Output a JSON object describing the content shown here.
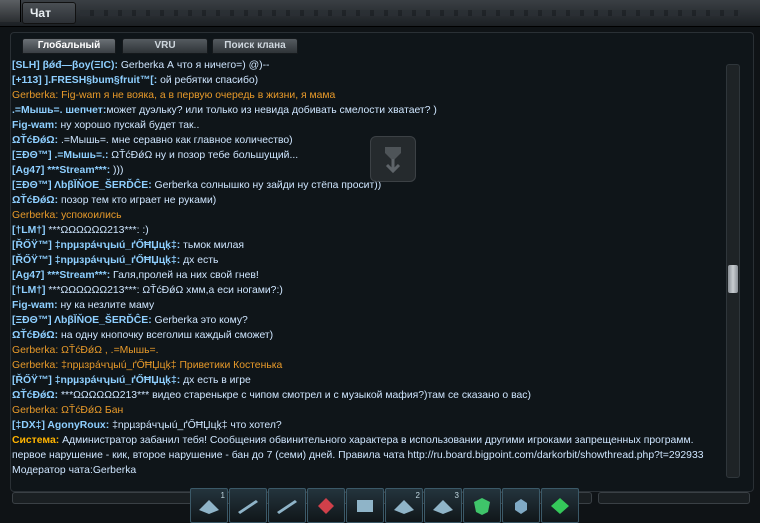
{
  "window": {
    "title": "Чат"
  },
  "tabs": [
    {
      "label": "Глобальный",
      "active": true
    },
    {
      "label": "VRU",
      "active": false
    },
    {
      "label": "Поиск клана",
      "active": false
    }
  ],
  "chat": [
    {
      "type": "user",
      "prefix": "[SLH] βǿđ—βoy(ΞIC):",
      "text": " Gerberka А что я ничего=) @)--"
    },
    {
      "type": "user",
      "prefix": "[+113] ].FRESH§bum§fruit™[:",
      "text": " ой ребятки спасибо)"
    },
    {
      "type": "pm",
      "prefix": "Gerberka:",
      "text": " Fig-wam  я не вояка, а в первую очередь в жизни, я мама"
    },
    {
      "type": "user",
      "prefix": ".=Мышь=. шепчет:",
      "text": "может дуэльку? или только из невида добивать смелости хватает? )"
    },
    {
      "type": "user",
      "prefix": "Fig-wam:",
      "text": " ну хорошо пускай будет так.."
    },
    {
      "type": "user",
      "prefix": "ΩŤćĐǿΩ:",
      "text": " .=Мышь=. мне серавно как главное количество)"
    },
    {
      "type": "user",
      "prefix": "[ΞĐΘ™] .=Мышь=.:",
      "text": " ΩŤćĐǿΩ ну и позор тебе большущий..."
    },
    {
      "type": "user",
      "prefix": "[Ag47] ***Stream***:",
      "text": " )))"
    },
    {
      "type": "user",
      "prefix": "[ΞĐΘ™] ΛbβĬŇOE_ŠERĎĈE:",
      "text": " Gerberka солнышко ну зайди ну стёпа просит))"
    },
    {
      "type": "user",
      "prefix": "ΩŤćĐǿΩ:",
      "text": " позор тем кто играет не руками)"
    },
    {
      "type": "pm",
      "prefix": "Gerberka:",
      "text": "  успокоились"
    },
    {
      "type": "user",
      "prefix": "[†LM†]",
      "text": " ***ΩΩΩΩΩΩ213***: :)"
    },
    {
      "type": "user",
      "prefix": "[ŘŐŸ™] ‡npµɜpáчʮыú_ґŐĦЏцķ‡:",
      "text": " тьмок милая"
    },
    {
      "type": "user",
      "prefix": "[ŘŐŸ™] ‡npµɜpáчʮыú_ґŐĦЏцķ‡:",
      "text": " дх есть"
    },
    {
      "type": "user",
      "prefix": "[Ag47] ***Stream***:",
      "text": " Галя,пролей на них свой гнев!"
    },
    {
      "type": "user",
      "prefix": "[†LM†]",
      "text": " ***ΩΩΩΩΩΩ213***: ΩŤćĐǿΩ хмм,а еси ногами?:)"
    },
    {
      "type": "user",
      "prefix": "Fig-wam:",
      "text": " ну ка незлите маму"
    },
    {
      "type": "user",
      "prefix": "[ΞĐΘ™] ΛbβĬŇOE_ŠERĎĈE:",
      "text": " Gerberka это кому?"
    },
    {
      "type": "user",
      "prefix": "ΩŤćĐǿΩ:",
      "text": " на одну кнопочку всеголиш каждый сможет)"
    },
    {
      "type": "pm",
      "prefix": "Gerberka:",
      "text": "  ΩŤćĐǿΩ , .=Мышь=."
    },
    {
      "type": "pm",
      "prefix": "Gerberka:",
      "text": "  ‡npµɜpáчʮыú_ґŐĦЏцķ‡ Приветики Костенька"
    },
    {
      "type": "user",
      "prefix": "[ŘŐŸ™] ‡npµɜpáчʮыú_ґŐĦЏцķ‡:",
      "text": " дх есть в  игре"
    },
    {
      "type": "user",
      "prefix": "ΩŤćĐǿΩ:",
      "text": " ***ΩΩΩΩΩΩ213*** видео старенькре с чипом смотрел и с музыкой мафия?)там се сказано о вас)"
    },
    {
      "type": "pm",
      "prefix": "Gerberka:",
      "text": "  ΩŤćĐǿΩ Бан"
    },
    {
      "type": "user",
      "prefix": "[‡DX‡] AgonyRoux:",
      "text": " ‡npµɜpáчʮыú_ґŐĦЏцķ‡ что хотел?"
    },
    {
      "type": "system",
      "prefix": "Система:",
      "text": " Администратор забанил тебя! Сообщения обвинительного характера в использовании другими игроками запрещенных программ. первое нарушение - кик, второе нарушение - бан до 7 (семи) дней. Правила чата http://ru.board.bigpoint.com/darkorbit/showthread.php?t=292933 Модератор чата:Gerberka"
    }
  ],
  "actionbar": [
    {
      "icon": "ship-icon",
      "qty": "1"
    },
    {
      "icon": "laser-icon",
      "qty": ""
    },
    {
      "icon": "laser-icon",
      "qty": ""
    },
    {
      "icon": "mine-icon",
      "qty": ""
    },
    {
      "icon": "missile-icon",
      "qty": ""
    },
    {
      "icon": "ship-icon",
      "qty": "2"
    },
    {
      "icon": "ship-icon",
      "qty": "3"
    },
    {
      "icon": "shield-icon",
      "qty": ""
    },
    {
      "icon": "gear-icon",
      "qty": ""
    },
    {
      "icon": "repair-icon",
      "qty": ""
    }
  ]
}
